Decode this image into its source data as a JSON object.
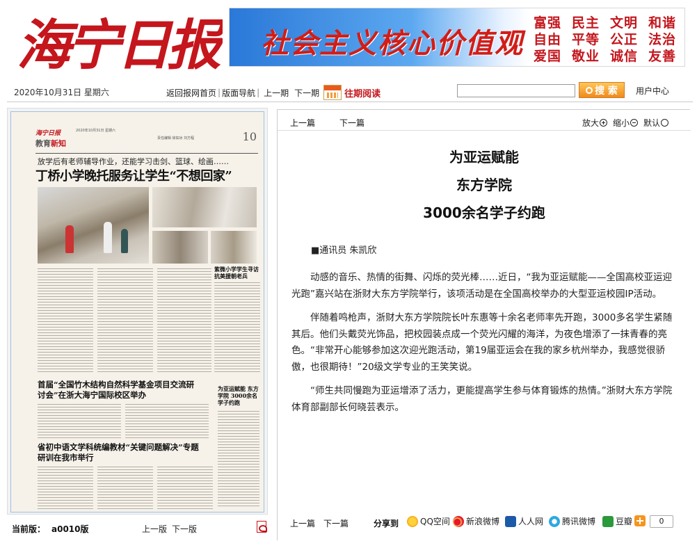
{
  "masthead": {
    "logo_text": "海宁日报",
    "banner_slogan": "社会主义核心价值观",
    "core_values": [
      [
        "富强",
        "民主",
        "文明",
        "和谐"
      ],
      [
        "自由",
        "平等",
        "公正",
        "法治"
      ],
      [
        "爱国",
        "敬业",
        "诚信",
        "友善"
      ]
    ],
    "colors": {
      "brand_red": "#c4161c",
      "banner_blue": "#2a78d8"
    }
  },
  "nav": {
    "date": "2020年10月31日 星期六",
    "links": [
      "返回报网首页",
      "版面导航",
      "上一期",
      "下一期"
    ],
    "archive": "往期阅读",
    "search_placeholder": "",
    "search_button": "搜 索",
    "user_center": "用户中心"
  },
  "newspaper_page": {
    "logo": "海宁日报",
    "date_line": "2020年10月31日 星期六",
    "meta_line": "责任编辑 徐如冰 刘方程",
    "section": "教育",
    "section_highlight": "新知",
    "page_number": "10",
    "sub_headline": "放学后有老师辅导作业，还能学习击剑、篮球、绘画……",
    "headline": "丁桥小学晚托服务让学生“不想回家”",
    "side_title": "紫微小学学生寻访抗美援朝老兵",
    "bottom_headline_1": "首届“全国竹木结构自然科学基金项目交流研讨会”在浙大海宁国际校区举办",
    "side_title_2": "为亚运赋能 东方学院 3000余名学子约跑",
    "bottom_headline_2": "省初中语文学科统编教材“关键问题解决”专题研训在我市举行"
  },
  "left_footer": {
    "current_label": "当前版：",
    "current_value": "a0010版",
    "prev": "上一版",
    "next": "下一版",
    "pdf_icon": "pdf-icon"
  },
  "article": {
    "nav_prev": "上一篇",
    "nav_next": "下一篇",
    "zoom_in": "放大",
    "zoom_out": "缩小",
    "zoom_reset": "默认",
    "title_lines": [
      "为亚运赋能",
      "东方学院",
      "3000余名学子约跑"
    ],
    "byline": "■通讯员 朱凯欣",
    "paragraphs": [
      "动感的音乐、热情的街舞、闪烁的荧光棒……近日，“我为亚运赋能——全国高校亚运迎光跑”嘉兴站在浙财大东方学院举行，该项活动是在全国高校举办的大型亚运校园IP活动。",
      "伴随着鸣枪声，浙财大东方学院院长叶东惠等十余名老师率先开跑，3000多名学生紧随其后。他们头戴荧光饰品，把校园装点成一个荧光闪耀的海洋，为夜色增添了一抹青春的亮色。“非常开心能够参加这次迎光跑活动，第19届亚运会在我的家乡杭州举办，我感觉很骄傲，也很期待！”20级文学专业的王笑笑说。",
      "“师生共同慢跑为亚运增添了活力，更能提高学生参与体育锻炼的热情。”浙财大东方学院体育部副部长何晓芸表示。"
    ],
    "footer": {
      "prev": "上一篇",
      "next": "下一篇",
      "share_label": "分享到",
      "share_targets": [
        "QQ空间",
        "新浪微博",
        "人人网",
        "腾讯微博",
        "豆瓣"
      ],
      "share_count": "0"
    }
  }
}
